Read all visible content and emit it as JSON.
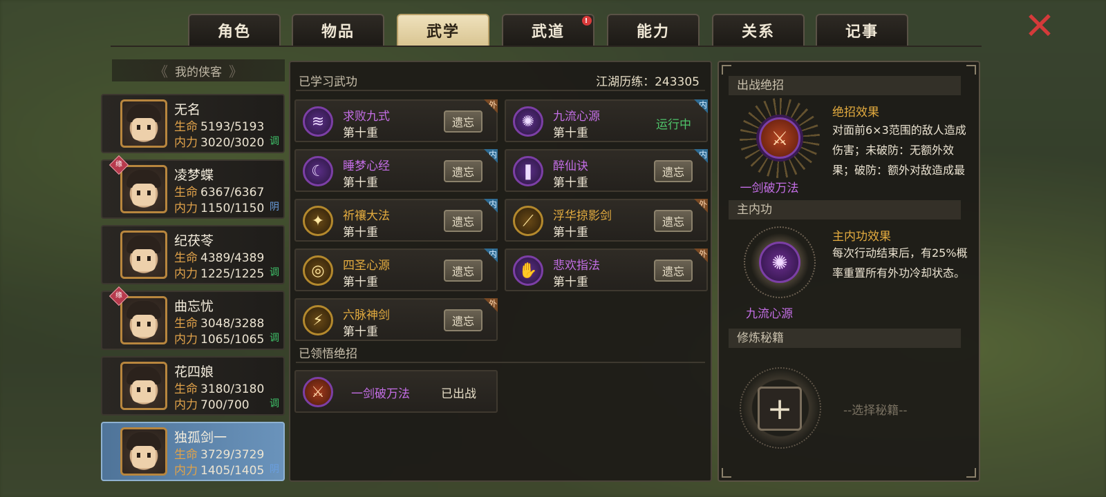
{
  "tabs": [
    {
      "label": "角色",
      "active": false,
      "notify": false
    },
    {
      "label": "物品",
      "active": false,
      "notify": false
    },
    {
      "label": "武学",
      "active": true,
      "notify": false
    },
    {
      "label": "武道",
      "active": false,
      "notify": true
    },
    {
      "label": "能力",
      "active": false,
      "notify": false
    },
    {
      "label": "关系",
      "active": false,
      "notify": false
    },
    {
      "label": "记事",
      "active": false,
      "notify": false
    }
  ],
  "notify_glyph": "!",
  "close_icon": "✕",
  "heroes_header": "我的侠客",
  "heroes": [
    {
      "name": "无名",
      "hp_label": "生命",
      "hp": "5193/5193",
      "mp_label": "内力",
      "mp": "3020/3020",
      "tag": "调",
      "tag_color": "#3fc46a",
      "ribbon": "",
      "selected": false
    },
    {
      "name": "凌梦蝶",
      "hp_label": "生命",
      "hp": "6367/6367",
      "mp_label": "内力",
      "mp": "1150/1150",
      "tag": "阴",
      "tag_color": "#6a9fe0",
      "ribbon": "缘",
      "selected": false
    },
    {
      "name": "纪茯苓",
      "hp_label": "生命",
      "hp": "4389/4389",
      "mp_label": "内力",
      "mp": "1225/1225",
      "tag": "调",
      "tag_color": "#3fc46a",
      "ribbon": "",
      "selected": false
    },
    {
      "name": "曲忘忧",
      "hp_label": "生命",
      "hp": "3048/3288",
      "mp_label": "内力",
      "mp": "1065/1065",
      "tag": "调",
      "tag_color": "#3fc46a",
      "ribbon": "缘",
      "selected": false
    },
    {
      "name": "花四娘",
      "hp_label": "生命",
      "hp": "3180/3180",
      "mp_label": "内力",
      "mp": "700/700",
      "tag": "调",
      "tag_color": "#3fc46a",
      "ribbon": "",
      "selected": false
    },
    {
      "name": "独孤剑一",
      "hp_label": "生命",
      "hp": "3729/3729",
      "mp_label": "内力",
      "mp": "1405/1405",
      "tag": "阴",
      "tag_color": "#6a9fe0",
      "ribbon": "",
      "selected": true
    }
  ],
  "learned": {
    "title": "已学习武功",
    "exp_label": "江湖历练：243305",
    "skills": [
      {
        "name": "求败九式",
        "level": "第十重",
        "action": "遗忘",
        "badge": "外",
        "badge_type": "wai",
        "color": "purple",
        "icon": "≋"
      },
      {
        "name": "九流心源",
        "level": "第十重",
        "action": "运行中",
        "badge": "内",
        "badge_type": "nei",
        "color": "purple",
        "icon": "✺",
        "running": true
      },
      {
        "name": "睡梦心经",
        "level": "第十重",
        "action": "遗忘",
        "badge": "内",
        "badge_type": "nei",
        "color": "purple",
        "icon": "☾"
      },
      {
        "name": "醉仙诀",
        "level": "第十重",
        "action": "遗忘",
        "badge": "内",
        "badge_type": "nei",
        "color": "purple",
        "icon": "❚"
      },
      {
        "name": "祈禳大法",
        "level": "第十重",
        "action": "遗忘",
        "badge": "内",
        "badge_type": "nei",
        "color": "gold",
        "icon": "✦"
      },
      {
        "name": "浮华掠影剑",
        "level": "第十重",
        "action": "遗忘",
        "badge": "外",
        "badge_type": "wai",
        "color": "gold",
        "icon": "⟋"
      },
      {
        "name": "四圣心源",
        "level": "第十重",
        "action": "遗忘",
        "badge": "内",
        "badge_type": "nei",
        "color": "gold",
        "icon": "◎"
      },
      {
        "name": "悲欢指法",
        "level": "第十重",
        "action": "遗忘",
        "badge": "外",
        "badge_type": "wai",
        "color": "purple",
        "icon": "✋"
      },
      {
        "name": "六脉神剑",
        "level": "第十重",
        "action": "遗忘",
        "badge": "外",
        "badge_type": "wai",
        "color": "gold",
        "icon": "⚡"
      }
    ]
  },
  "ultimates": {
    "title": "已领悟绝招",
    "items": [
      {
        "name": "一剑破万法",
        "status": "已出战",
        "icon": "⚔"
      }
    ]
  },
  "right_panel": {
    "battle_ult_title": "出战绝招",
    "battle_ult_name": "一剑破万法",
    "battle_ult_icon": "⚔",
    "effect_title": "绝招效果",
    "effect_text": "对面前6×3范围的敌人造成伤害；未破防：无额外效果；破防：额外对敌造成最",
    "main_inner_title": "主内功",
    "main_inner_name": "九流心源",
    "main_inner_icon": "✺",
    "inner_effect_title": "主内功效果",
    "inner_effect_text": "每次行动结束后，有25%概率重置所有外功冷却状态。",
    "manual_title": "修炼秘籍",
    "manual_add": "+",
    "manual_hint": "--选择秘籍--"
  }
}
